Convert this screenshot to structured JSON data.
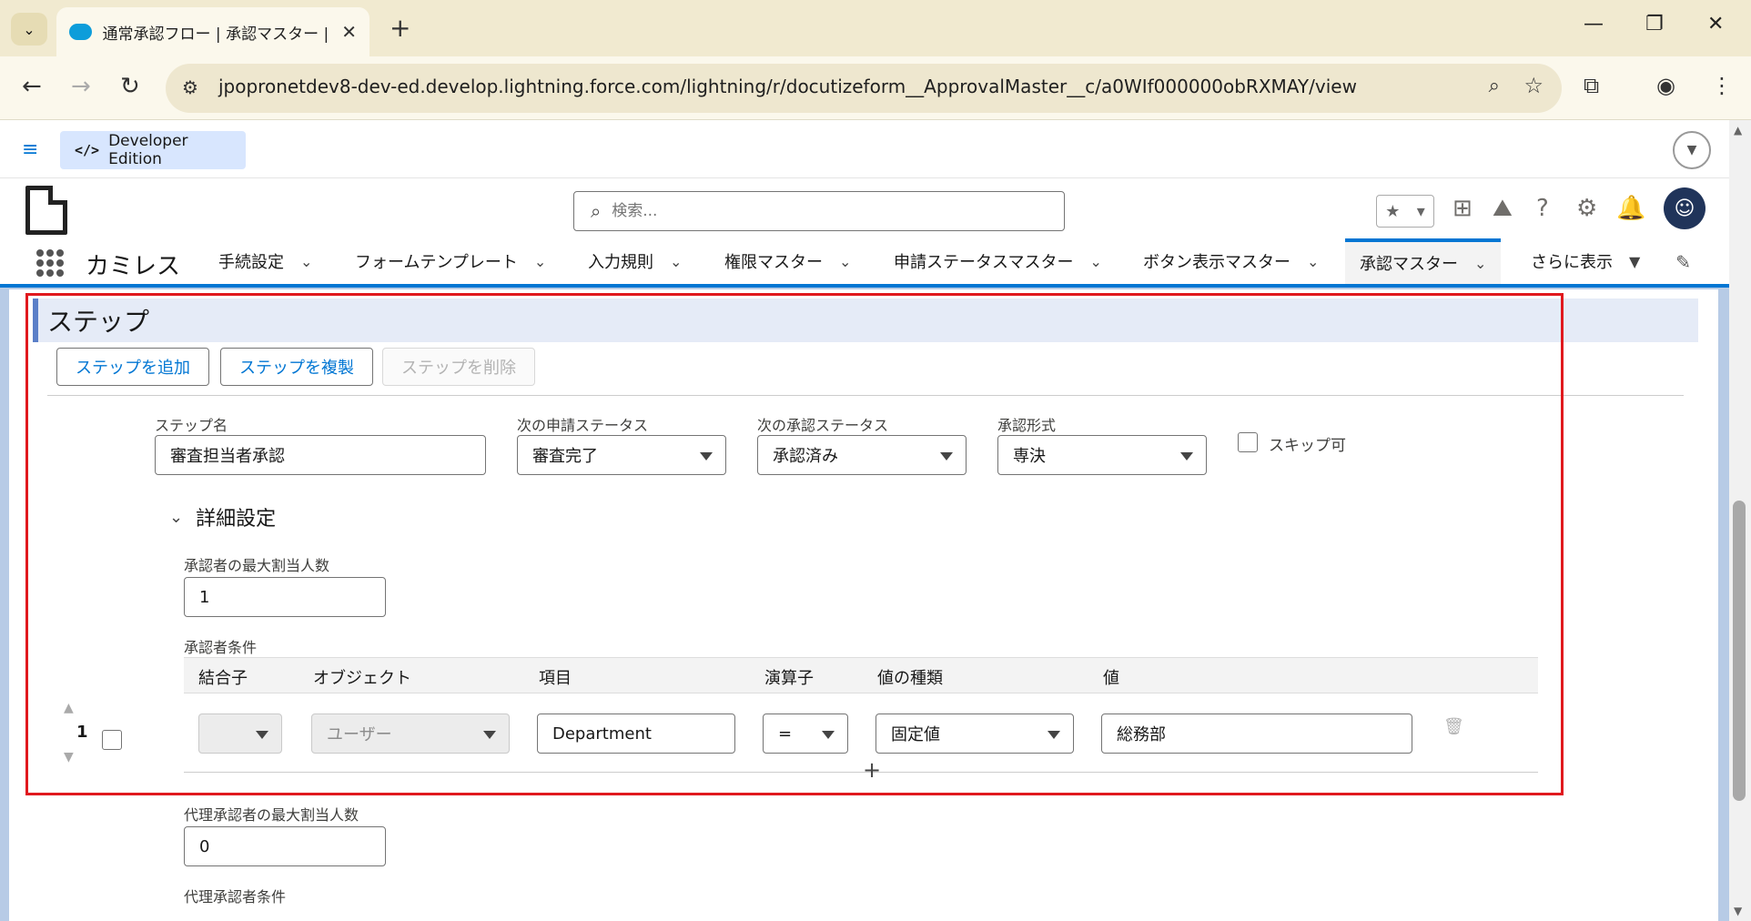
{
  "browser": {
    "tab_title": "通常承認フロー | 承認マスター | Sal",
    "tab_close": "✕",
    "new_tab": "+",
    "url": "jpopronetdev8-dev-ed.develop.lightning.force.com/lightning/r/docutizeform__ApprovalMaster__c/a0WIf000000obRXMAY/view"
  },
  "sf": {
    "edition": "Developer Edition",
    "edition_icon": "</>",
    "search_placeholder": "検索...",
    "app_name": "カミレス",
    "nav": [
      {
        "label": "手続設定"
      },
      {
        "label": "フォームテンプレート"
      },
      {
        "label": "入力規則"
      },
      {
        "label": "権限マスター"
      },
      {
        "label": "申請ステータスマスター"
      },
      {
        "label": "ボタン表示マスター"
      },
      {
        "label": "承認マスター"
      },
      {
        "label": "さらに表示"
      }
    ]
  },
  "step": {
    "section_title": "ステップ",
    "buttons": {
      "add": "ステップを追加",
      "copy": "ステップを複製",
      "delete": "ステップを削除"
    },
    "fields": {
      "name_label": "ステップ名",
      "name_value": "審査担当者承認",
      "next_app_status_label": "次の申請ステータス",
      "next_app_status_value": "審査完了",
      "next_approval_status_label": "次の承認ステータス",
      "next_approval_status_value": "承認済み",
      "approval_type_label": "承認形式",
      "approval_type_value": "専決",
      "skip_label": "スキップ可"
    },
    "details": {
      "toggle_label": "詳細設定",
      "max_approvers_label": "承認者の最大割当人数",
      "max_approvers_value": "1",
      "conditions_label": "承認者条件",
      "columns": {
        "join": "結合子",
        "object": "オブジェクト",
        "field": "項目",
        "operator": "演算子",
        "value_type": "値の種類",
        "value": "値"
      },
      "row": {
        "number": "1",
        "join": "",
        "object": "ユーザー",
        "field": "Department",
        "operator": "=",
        "value_type": "固定値",
        "value": "総務部"
      },
      "proxy_max_label": "代理承認者の最大割当人数",
      "proxy_max_value": "0",
      "proxy_conditions_label": "代理承認者条件"
    }
  },
  "colors": {
    "brand_blue": "#0176d3",
    "highlight_red": "#e0191e",
    "tab_bar": "#f1ead0"
  }
}
